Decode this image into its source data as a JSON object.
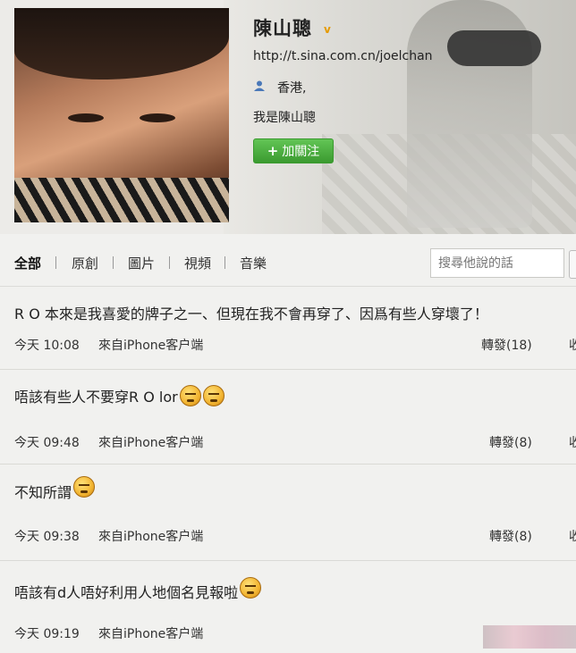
{
  "profile": {
    "name": "陳山聰",
    "verified_mark": "v",
    "url": "http://t.sina.com.cn/joelchan",
    "location": "香港,",
    "bio": "我是陳山聰",
    "follow_label": "加關注"
  },
  "tabs": [
    {
      "label": "全部",
      "active": true
    },
    {
      "label": "原創",
      "active": false
    },
    {
      "label": "圖片",
      "active": false
    },
    {
      "label": "視頻",
      "active": false
    },
    {
      "label": "音樂",
      "active": false
    }
  ],
  "search": {
    "placeholder": "搜尋他說的話"
  },
  "posts": [
    {
      "text": "R O 本來是我喜愛的牌子之一、但現在我不會再穿了、因爲有些人穿壞了！",
      "emoji": 0,
      "time": "今天 10:08",
      "source": "來自iPhone客户端",
      "repost": "轉發(18)",
      "fav": "收"
    },
    {
      "text": "唔該有些人不要穿R O lor",
      "emoji": 2,
      "time": "今天 09:48",
      "source": "來自iPhone客户端",
      "repost": "轉發(8)",
      "fav": "收"
    },
    {
      "text": "不知所謂",
      "emoji": 1,
      "time": "今天 09:38",
      "source": "來自iPhone客户端",
      "repost": "轉發(8)",
      "fav": "收"
    },
    {
      "text": "唔該有d人唔好利用人地個名見報啦",
      "emoji": 1,
      "time": "今天 09:19",
      "source": "來自iPhone客户端",
      "repost": "",
      "fav": ""
    }
  ],
  "icons": {
    "location": "person-location-icon",
    "emoji": "angry-face-emoji-icon"
  },
  "colors": {
    "follow_button": "#3b9a30",
    "verified": "#e59a00"
  }
}
